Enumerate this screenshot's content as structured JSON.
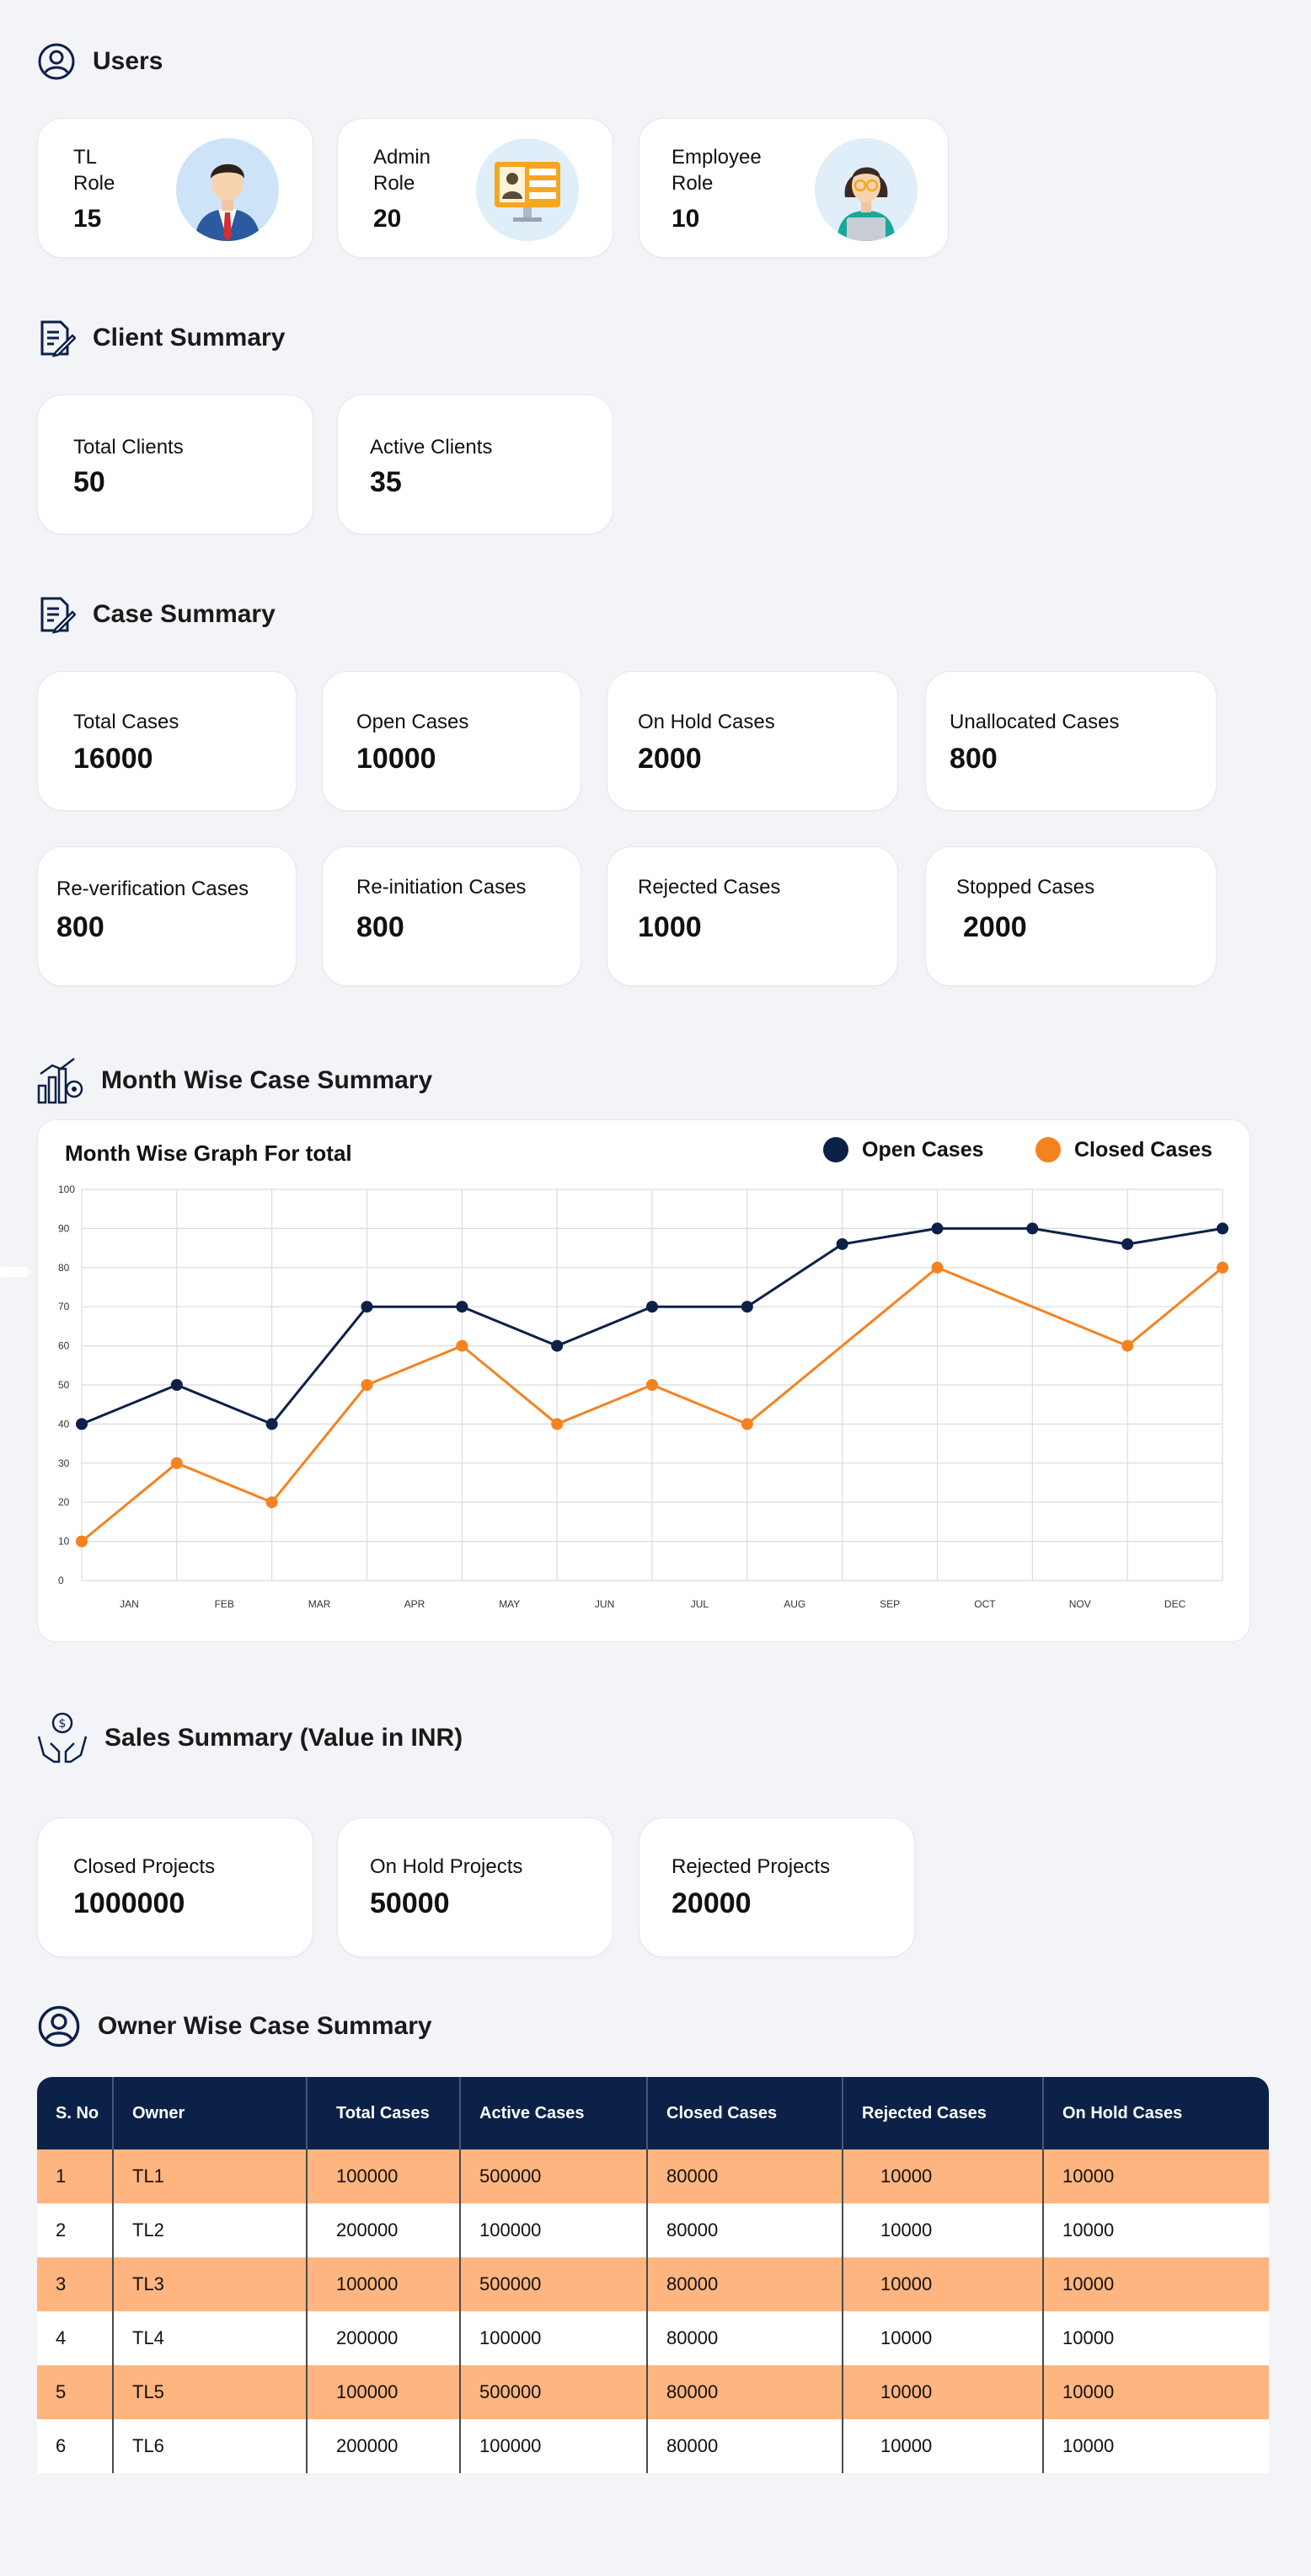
{
  "users": {
    "title": "Users",
    "cards": [
      {
        "line1": "TL",
        "line2": "Role",
        "value": "15"
      },
      {
        "line1": "Admin",
        "line2": "Role",
        "value": "20"
      },
      {
        "line1": "Employee",
        "line2": "Role",
        "value": "10"
      }
    ]
  },
  "client_summary": {
    "title": "Client Summary",
    "cards": [
      {
        "label": "Total Clients",
        "value": "50"
      },
      {
        "label": "Active Clients",
        "value": "35"
      }
    ]
  },
  "case_summary": {
    "title": "Case Summary",
    "cards": [
      {
        "label": "Total Cases",
        "value": "16000"
      },
      {
        "label": "Open Cases",
        "value": "10000"
      },
      {
        "label": "On Hold Cases",
        "value": "2000"
      },
      {
        "label": "Unallocated Cases",
        "value": "800"
      },
      {
        "label": "Re-verification Cases",
        "value": "800"
      },
      {
        "label": "Re-initiation Cases",
        "value": "800"
      },
      {
        "label": "Rejected Cases",
        "value": "1000"
      },
      {
        "label": "Stopped Cases",
        "value": "2000"
      }
    ]
  },
  "month_wise": {
    "title": "Month Wise Case Summary"
  },
  "chart_data": {
    "type": "line",
    "title": "Month Wise Graph For total",
    "categories": [
      "JAN",
      "FEB",
      "MAR",
      "APR",
      "MAY",
      "JUN",
      "JUL",
      "AUG",
      "SEP",
      "OCT",
      "NOV",
      "DEC"
    ],
    "x": [
      0,
      1,
      2,
      3,
      4,
      5,
      6,
      7,
      8,
      9,
      10,
      11,
      12
    ],
    "series": [
      {
        "name": "Open Cases",
        "color": "#0c2148",
        "points": [
          [
            0,
            40
          ],
          [
            1,
            50
          ],
          [
            2,
            40
          ],
          [
            3,
            70
          ],
          [
            4,
            70
          ],
          [
            5,
            60
          ],
          [
            6,
            70
          ],
          [
            7,
            70
          ],
          [
            8,
            86
          ],
          [
            9,
            90
          ],
          [
            10,
            90
          ],
          [
            11,
            86
          ],
          [
            12,
            90
          ]
        ]
      },
      {
        "name": "Closed Cases",
        "color": "#f5821f",
        "points": [
          [
            0,
            10
          ],
          [
            1,
            30
          ],
          [
            2,
            20
          ],
          [
            3,
            50
          ],
          [
            4,
            60
          ],
          [
            5,
            40
          ],
          [
            6,
            50
          ],
          [
            7,
            40
          ],
          [
            9,
            80
          ],
          [
            11,
            60
          ],
          [
            12,
            80
          ]
        ]
      }
    ],
    "yticks": [
      "0",
      "10",
      "20",
      "30",
      "40",
      "50",
      "60",
      "70",
      "80",
      "90",
      "100"
    ],
    "ylim": [
      0,
      100
    ],
    "grid": true,
    "legend": "top-right",
    "xlabel": "",
    "ylabel": ""
  },
  "sales": {
    "title": "Sales Summary (Value in INR)",
    "cards": [
      {
        "label": "Closed Projects",
        "value": "1000000"
      },
      {
        "label": "On Hold Projects",
        "value": "50000"
      },
      {
        "label": "Rejected Projects",
        "value": "20000"
      }
    ]
  },
  "owner": {
    "title": "Owner Wise Case Summary",
    "columns": [
      "S. No",
      "Owner",
      "Total Cases",
      "Active Cases",
      "Closed Cases",
      "Rejected Cases",
      "On Hold Cases"
    ],
    "rows": [
      [
        "1",
        "TL1",
        "100000",
        "500000",
        "80000",
        "10000",
        "10000"
      ],
      [
        "2",
        "TL2",
        "200000",
        "100000",
        "80000",
        "10000",
        "10000"
      ],
      [
        "3",
        "TL3",
        "100000",
        "500000",
        "80000",
        "10000",
        "10000"
      ],
      [
        "4",
        "TL4",
        "200000",
        "100000",
        "80000",
        "10000",
        "10000"
      ],
      [
        "5",
        "TL5",
        "100000",
        "500000",
        "80000",
        "10000",
        "10000"
      ],
      [
        "6",
        "TL6",
        "200000",
        "100000",
        "80000",
        "10000",
        "10000"
      ]
    ]
  },
  "colors": {
    "navy": "#0c2148",
    "orange": "#f5821f",
    "row_highlight": "#ffb580",
    "background": "#f3f4f8"
  },
  "icons": [
    "user-circle-icon",
    "edit-document-icon",
    "chart-gear-icon",
    "money-hands-icon"
  ]
}
